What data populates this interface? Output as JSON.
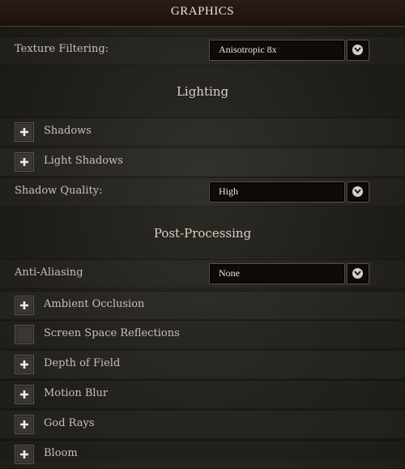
{
  "header": {
    "title": "GRAPHICS"
  },
  "texture_filtering": {
    "label": "Texture Filtering:",
    "value": "Anisotropic 8x"
  },
  "lighting": {
    "heading": "Lighting",
    "shadows": {
      "label": "Shadows",
      "checked": true
    },
    "light_shadows": {
      "label": "Light Shadows",
      "checked": true
    },
    "shadow_quality": {
      "label": "Shadow Quality:",
      "value": "High"
    }
  },
  "post_processing": {
    "heading": "Post-Processing",
    "anti_aliasing": {
      "label": "Anti-Aliasing",
      "value": "None"
    },
    "ambient_occlusion": {
      "label": "Ambient Occlusion",
      "checked": true
    },
    "ssr": {
      "label": "Screen Space Reflections",
      "checked": false
    },
    "depth_of_field": {
      "label": "Depth of Field",
      "checked": true
    },
    "motion_blur": {
      "label": "Motion Blur",
      "checked": true
    },
    "god_rays": {
      "label": "God Rays",
      "checked": true
    },
    "bloom": {
      "label": "Bloom",
      "checked": true
    }
  },
  "icons": {
    "checkbox_mark": "cross-icon",
    "dropdown": "chevron-down-icon"
  }
}
